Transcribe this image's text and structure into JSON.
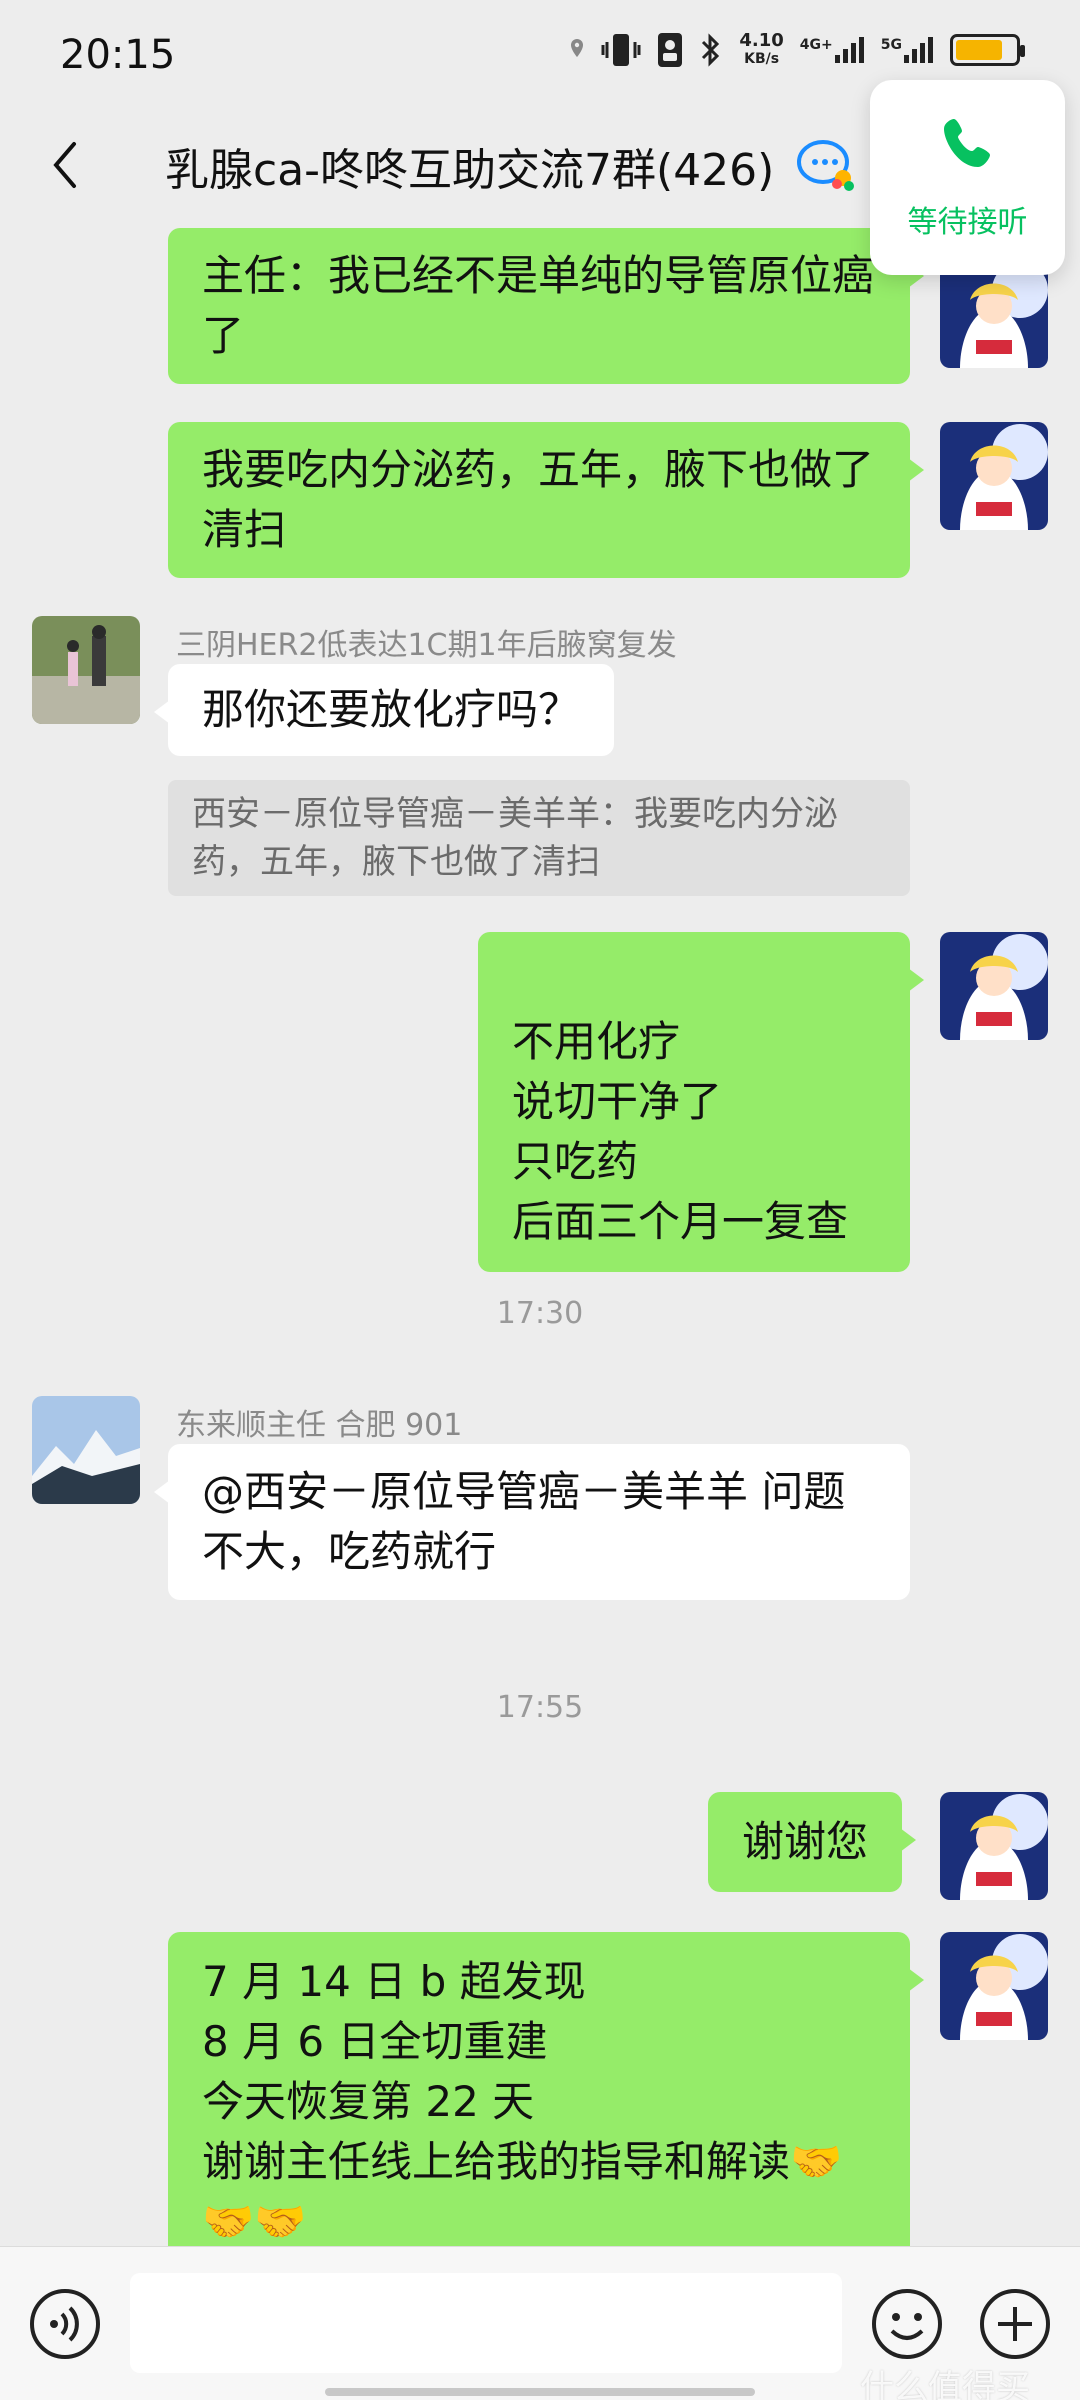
{
  "status_bar": {
    "time": "20:15",
    "speed_value": "4.10",
    "speed_unit": "KB/s",
    "net1": "4G+",
    "net2": "5G",
    "battery_color": "#f6b400"
  },
  "header": {
    "title": "乳腺ca-咚咚互助交流7群(426)",
    "back_icon": "chevron-left-icon",
    "emoji_icon": "chat-bubbles-icon"
  },
  "call_overlay": {
    "label": "等待接听",
    "icon": "phone-icon",
    "color": "#07c160"
  },
  "messages": [
    {
      "side": "right",
      "text": "主任：我已经不是单纯的导管原位癌了"
    },
    {
      "side": "right",
      "text": "我要吃内分泌药，五年，腋下也做了清扫"
    },
    {
      "side": "left",
      "sender": "三阴HER2低表达1C期1年后腋窝复发",
      "text": "那你还要放化疗吗？",
      "quote": "西安－原位导管癌－美羊羊：我要吃内分泌药，五年，腋下也做了清扫"
    },
    {
      "side": "right",
      "text": "不用化疗\n说切干净了\n只吃药\n后面三个月一复查"
    },
    {
      "type": "time",
      "text": "17:30"
    },
    {
      "side": "left",
      "sender": "东来顺主任 合肥 901",
      "text": "@西安－原位导管癌－美羊羊  问题不大，吃药就行"
    },
    {
      "type": "time",
      "text": "17:55"
    },
    {
      "side": "right",
      "text": "谢谢您"
    },
    {
      "side": "right",
      "text": "7 月 14 日 b 超发现\n8 月 6 日全切重建\n今天恢复第 22 天\n谢谢主任线上给我的指导和解读🤝\n🤝🤝"
    }
  ],
  "input_bar": {
    "voice_icon": "voice-icon",
    "emoji_icon": "smiley-icon",
    "plus_icon": "plus-icon"
  },
  "watermark": "什么值得买",
  "colors": {
    "bg": "#ededed",
    "bubble_self": "#95ec69",
    "bubble_other": "#ffffff"
  }
}
